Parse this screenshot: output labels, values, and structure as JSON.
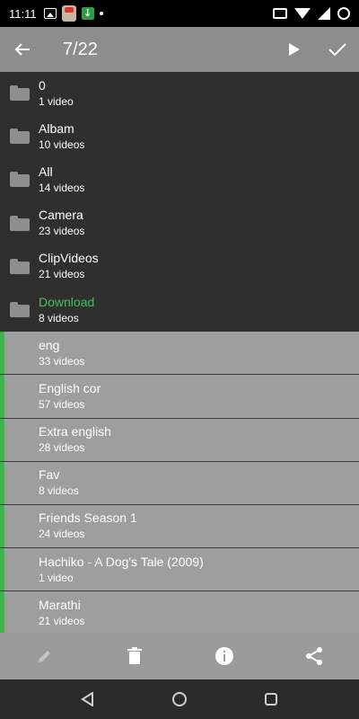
{
  "status_bar": {
    "time": "11:11"
  },
  "toolbar": {
    "title": "7/22"
  },
  "folders": [
    {
      "name": "0",
      "count": "1 video",
      "selected": false,
      "accent": false
    },
    {
      "name": "Albam",
      "count": "10 videos",
      "selected": false,
      "accent": false
    },
    {
      "name": "All",
      "count": "14 videos",
      "selected": false,
      "accent": false
    },
    {
      "name": "Camera",
      "count": "23 videos",
      "selected": false,
      "accent": false
    },
    {
      "name": "ClipVideos",
      "count": "21 videos",
      "selected": false,
      "accent": false
    },
    {
      "name": "Download",
      "count": "8 videos",
      "selected": false,
      "accent": true
    },
    {
      "name": "eng",
      "count": "33 videos",
      "selected": true,
      "accent": false
    },
    {
      "name": "English cor",
      "count": "57 videos",
      "selected": true,
      "accent": false
    },
    {
      "name": "Extra english",
      "count": "28 videos",
      "selected": true,
      "accent": false
    },
    {
      "name": "Fav",
      "count": "8 videos",
      "selected": true,
      "accent": false
    },
    {
      "name": "Friends Season 1",
      "count": "24 videos",
      "selected": true,
      "accent": false
    },
    {
      "name": "Hachiko - A Dog's Tale (2009)",
      "count": "1 video",
      "selected": true,
      "accent": false
    },
    {
      "name": "Marathi",
      "count": "21 videos",
      "selected": true,
      "accent": false
    }
  ],
  "colors": {
    "accent": "#45c04f",
    "toolbar": "#8d8d8d",
    "selected_row": "#9e9e9e",
    "list_bg": "#2f2f2f"
  },
  "icons": [
    "back-arrow-icon",
    "play-icon",
    "check-icon",
    "folder-icon",
    "edit-icon",
    "delete-icon",
    "info-icon",
    "share-icon"
  ]
}
